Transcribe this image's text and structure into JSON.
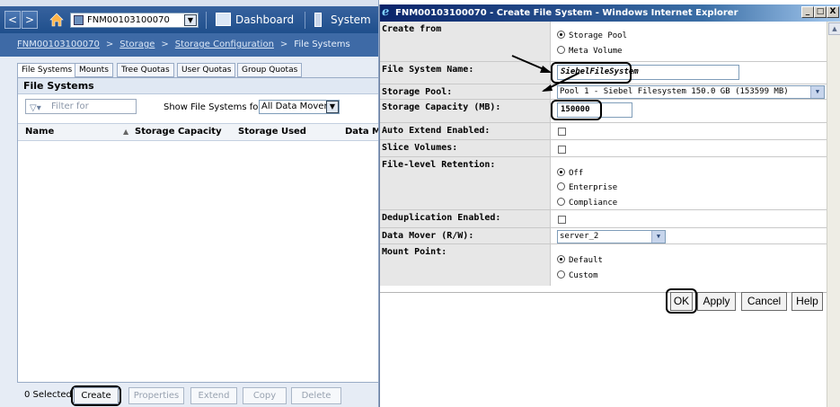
{
  "left_app": {
    "toolbar": {
      "back_symbol": "<",
      "forward_symbol": ">",
      "home_icon": "home-icon",
      "system_selector": "FNM00103100070",
      "dashboard_label": "Dashboard",
      "system_label": "System"
    },
    "breadcrumb": {
      "items": [
        "FNM00103100070",
        "Storage",
        "Storage Configuration"
      ],
      "separator": ">",
      "current": "File Systems"
    },
    "tabs": [
      "File Systems",
      "Mounts",
      "Tree Quotas",
      "User Quotas",
      "Group Quotas"
    ],
    "panel": {
      "title": "File Systems",
      "filter_placeholder": "Filter for",
      "show_label": "Show File Systems for",
      "data_mover_option": "All Data Movers",
      "columns": [
        "Name",
        "Storage Capacity",
        "Storage Used",
        "Data M"
      ]
    },
    "bottom": {
      "selected_count": "0 Selected",
      "buttons": [
        "Create",
        "Properties",
        "Extend",
        "Copy",
        "Delete"
      ]
    }
  },
  "popup": {
    "title": "FNM00103100070 - Create File System - Windows Internet Explorer",
    "window_buttons": [
      "_",
      "□",
      "X"
    ],
    "form": {
      "create_from": {
        "label": "Create from",
        "options": [
          "Storage Pool",
          "Meta Volume"
        ],
        "selected": "Storage Pool"
      },
      "fs_name": {
        "label": "File System Name:",
        "value": "SiebelFileSystem"
      },
      "storage_pool": {
        "label": "Storage Pool:",
        "value": "Pool 1 - Siebel Filesystem 150.0 GB (153599 MB)"
      },
      "storage_capacity": {
        "label": "Storage Capacity (MB):",
        "value": "150000"
      },
      "auto_extend": {
        "label": "Auto Extend Enabled:",
        "checked": false
      },
      "slice_volumes": {
        "label": "Slice Volumes:",
        "checked": false
      },
      "retention": {
        "label": "File-level Retention:",
        "options": [
          "Off",
          "Enterprise",
          "Compliance"
        ],
        "selected": "Off"
      },
      "dedup": {
        "label": "Deduplication Enabled:",
        "checked": false
      },
      "data_mover": {
        "label": "Data Mover (R/W):",
        "value": "server_2"
      },
      "mount_point": {
        "label": "Mount Point:",
        "options": [
          "Default",
          "Custom"
        ],
        "selected": "Default"
      }
    },
    "buttons": [
      "OK",
      "Apply",
      "Cancel",
      "Help"
    ]
  }
}
